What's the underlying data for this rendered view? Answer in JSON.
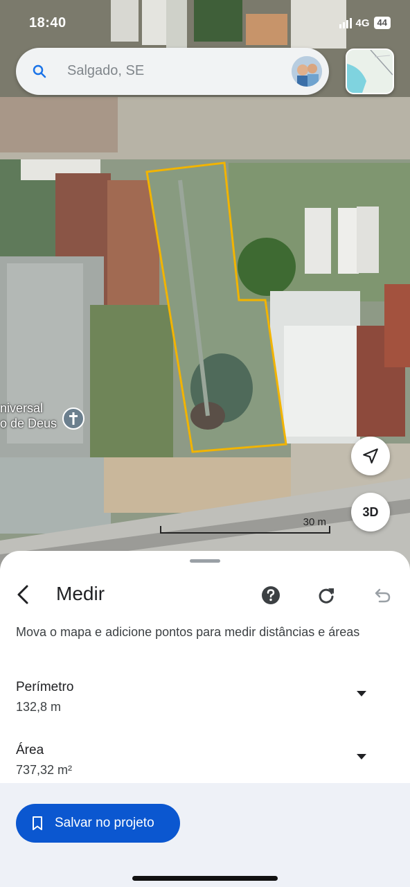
{
  "status_bar": {
    "time": "18:40",
    "network": "4G",
    "battery": "44"
  },
  "search": {
    "text": "Salgado, SE",
    "icon": "search-icon",
    "avatar": "profile-avatar"
  },
  "map": {
    "poi_label_line1": "niversal",
    "poi_label_line2": "o de Deus",
    "poi_icon": "church-cross-icon",
    "scale_label": "30 m",
    "btn_3d": "3D",
    "nav_icon": "navigation-arrow-icon",
    "polygon_color": "#f2b400"
  },
  "sheet": {
    "title": "Medir",
    "description": "Mova o mapa e adicione pontos para medir distâncias e áreas",
    "icons": {
      "back": "back-arrow-icon",
      "help": "help-icon",
      "redo": "redo-icon",
      "undo": "undo-icon",
      "dropdown": "dropdown-arrow-icon"
    },
    "perimeter": {
      "label": "Perímetro",
      "value": "132,8 m"
    },
    "area": {
      "label": "Área",
      "value": "737,32 m²"
    },
    "save_button": "Salvar no projeto",
    "accent": "#0b57d0"
  }
}
